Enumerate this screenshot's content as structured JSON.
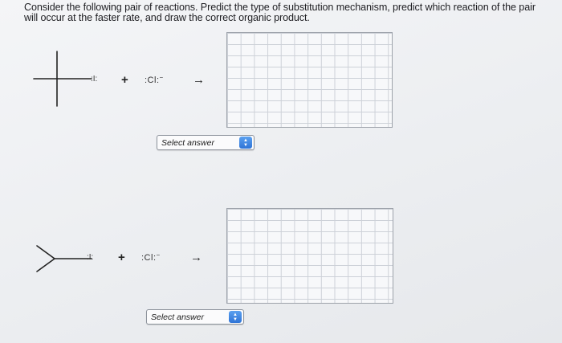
{
  "question": {
    "text": "Consider the following pair of reactions. Predict the type of substitution mechanism, predict which reaction of the pair will occur at the faster rate, and draw the correct organic product."
  },
  "reactions": [
    {
      "leaving_group": ":I:",
      "plus": "+",
      "nucleophile": ":Cl:",
      "nucleophile_charge": "−",
      "arrow": "→",
      "select_value": "Select answer"
    },
    {
      "leaving_group": ":I:",
      "plus": "+",
      "nucleophile": ":Cl:",
      "nucleophile_charge": "−",
      "arrow": "→",
      "select_value": "Select answer"
    }
  ],
  "icons": {
    "select_stepper": "up-down-chevron-icon"
  },
  "colors": {
    "stepper_accent": "#3a82e0",
    "grid_line": "#cdd1d8"
  }
}
